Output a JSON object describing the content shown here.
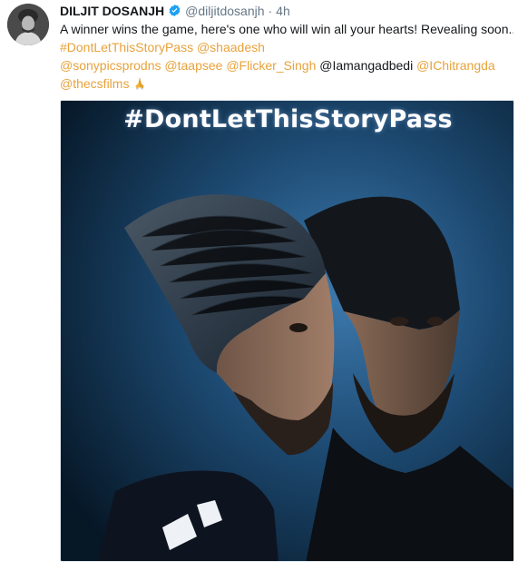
{
  "tweet": {
    "author_name": "DILJIT DOSANJH",
    "handle": "@diljitdosanjh",
    "separator": "·",
    "time": "4h",
    "text_line1": "A winner wins the game, here's one who will win all your hearts! Revealing soon...",
    "hashtag": "#DontLetThisStoryPass",
    "mentions": [
      "@shaadesh",
      "@sonypicsprodns",
      "@taapsee",
      "@Flicker_Singh",
      "@Iamangadbedi",
      "@IChitrangda",
      "@thecsfilms"
    ],
    "emoji": "folded-hands-icon"
  },
  "poster": {
    "title": "#DontLetThisStoryPass"
  },
  "colors": {
    "link": "#e8a23b",
    "name": "#14171a",
    "muted": "#657786",
    "verified": "#1da1f2"
  }
}
